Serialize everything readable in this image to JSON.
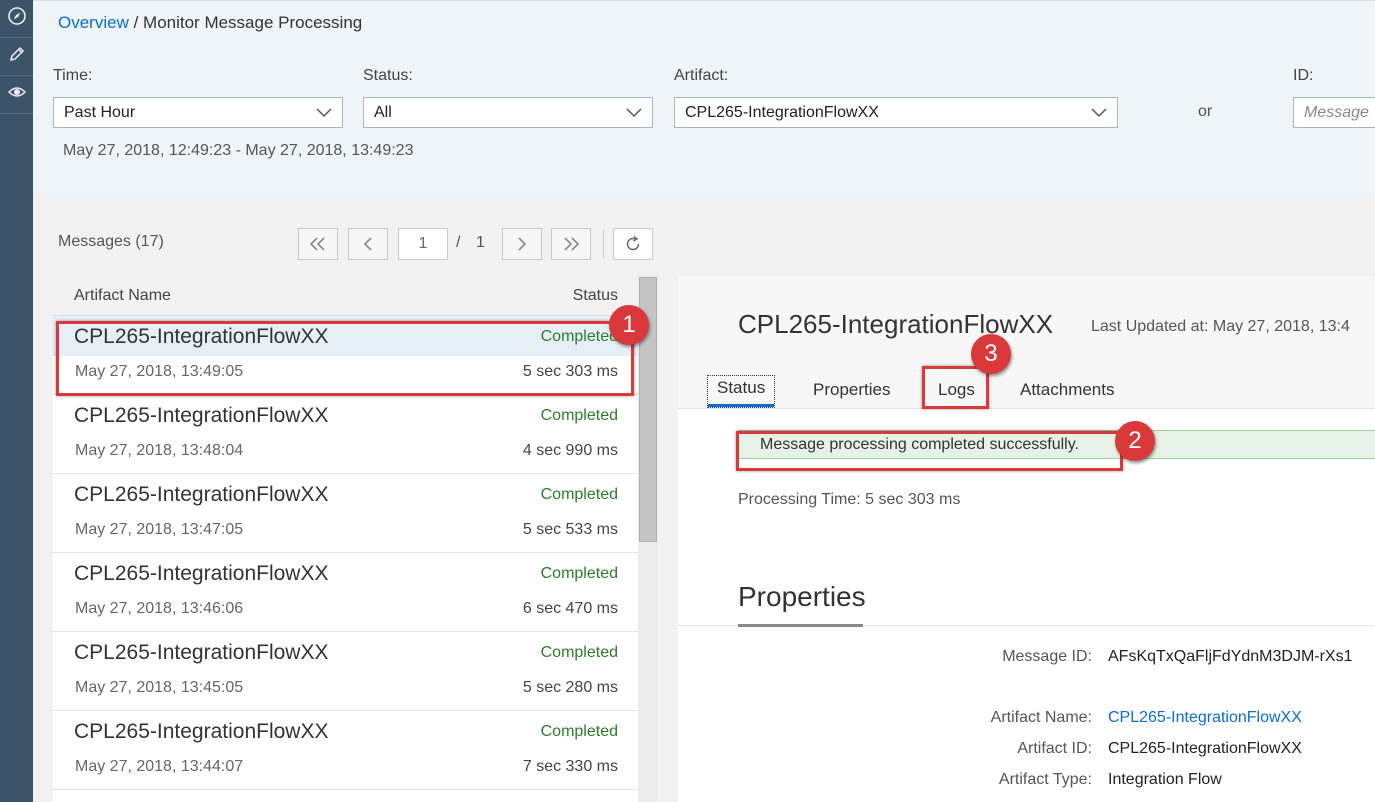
{
  "breadcrumb": {
    "root": "Overview",
    "separator": " / ",
    "current": "Monitor Message Processing"
  },
  "rail": {
    "icons": [
      "compass-icon",
      "pencil-icon",
      "eye-icon"
    ]
  },
  "filters": {
    "time_label": "Time:",
    "time_value": "Past Hour",
    "status_label": "Status:",
    "status_value": "All",
    "artifact_label": "Artifact:",
    "artifact_value": "CPL265-IntegrationFlowXX",
    "or_text": "or",
    "id_label": "ID:",
    "id_placeholder": "Message",
    "time_range": "May 27, 2018, 12:49:23 - May 27, 2018, 13:49:23"
  },
  "list": {
    "title": "Messages (17)",
    "page_current": "1",
    "page_separator": "/",
    "page_total": "1",
    "col_name": "Artifact Name",
    "col_status": "Status",
    "rows": [
      {
        "name": "CPL265-IntegrationFlowXX",
        "status": "Completed",
        "time": "May 27, 2018, 13:49:05",
        "duration": "5 sec 303 ms"
      },
      {
        "name": "CPL265-IntegrationFlowXX",
        "status": "Completed",
        "time": "May 27, 2018, 13:48:04",
        "duration": "4 sec 990 ms"
      },
      {
        "name": "CPL265-IntegrationFlowXX",
        "status": "Completed",
        "time": "May 27, 2018, 13:47:05",
        "duration": "5 sec 533 ms"
      },
      {
        "name": "CPL265-IntegrationFlowXX",
        "status": "Completed",
        "time": "May 27, 2018, 13:46:06",
        "duration": "6 sec 470 ms"
      },
      {
        "name": "CPL265-IntegrationFlowXX",
        "status": "Completed",
        "time": "May 27, 2018, 13:45:05",
        "duration": "5 sec 280 ms"
      },
      {
        "name": "CPL265-IntegrationFlowXX",
        "status": "Completed",
        "time": "May 27, 2018, 13:44:07",
        "duration": "7 sec 330 ms"
      }
    ]
  },
  "detail": {
    "title": "CPL265-IntegrationFlowXX",
    "last_updated": "Last Updated at: May 27, 2018, 13:4",
    "tabs": [
      "Status",
      "Properties",
      "Logs",
      "Attachments"
    ],
    "success_message": "Message processing completed successfully.",
    "processing_time": "Processing Time: 5 sec 303 ms",
    "properties_title": "Properties",
    "message_id_label": "Message ID:",
    "message_id_value": "AFsKqTxQaFljFdYdnM3DJM-rXs1",
    "artifact_name_label": "Artifact Name:",
    "artifact_name_value": "CPL265-IntegrationFlowXX",
    "artifact_id_label": "Artifact ID:",
    "artifact_id_value": "CPL265-IntegrationFlowXX",
    "artifact_type_label": "Artifact Type:",
    "artifact_type_value": "Integration Flow"
  },
  "callouts": [
    "1",
    "2",
    "3"
  ],
  "colors": {
    "accent": "#0a6ed1",
    "success": "#2b7d2b",
    "callout": "#d9393b",
    "rail": "#3d5367"
  }
}
